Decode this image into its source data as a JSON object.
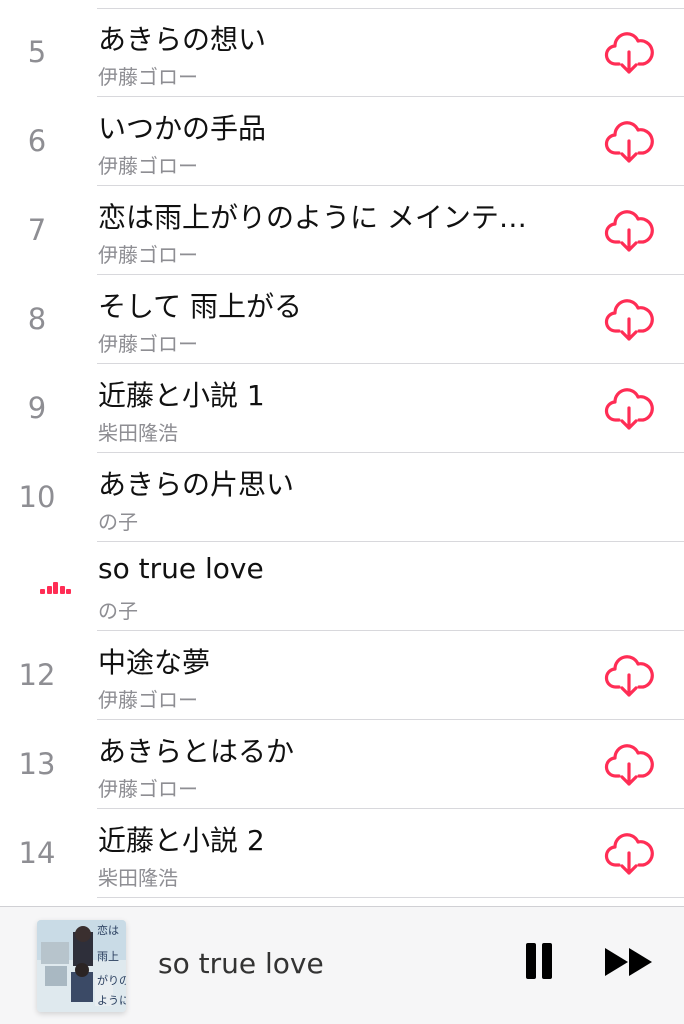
{
  "tracks": [
    {
      "num": "5",
      "title": "あきらの想い",
      "artist": "伊藤ゴロー",
      "downloadable": true,
      "playing": false
    },
    {
      "num": "6",
      "title": "いつかの手品",
      "artist": "伊藤ゴロー",
      "downloadable": true,
      "playing": false
    },
    {
      "num": "7",
      "title": "恋は雨上がりのように メインテ…",
      "artist": "伊藤ゴロー",
      "downloadable": true,
      "playing": false
    },
    {
      "num": "8",
      "title": "そして 雨上がる",
      "artist": "伊藤ゴロー",
      "downloadable": true,
      "playing": false
    },
    {
      "num": "9",
      "title": "近藤と小説 1",
      "artist": "柴田隆浩",
      "downloadable": true,
      "playing": false
    },
    {
      "num": "10",
      "title": "あきらの片思い",
      "artist": "の子",
      "downloadable": false,
      "playing": false
    },
    {
      "num": "",
      "title": "so true love",
      "artist": "の子",
      "downloadable": false,
      "playing": true
    },
    {
      "num": "12",
      "title": "中途な夢",
      "artist": "伊藤ゴロー",
      "downloadable": true,
      "playing": false
    },
    {
      "num": "13",
      "title": "あきらとはるか",
      "artist": "伊藤ゴロー",
      "downloadable": true,
      "playing": false
    },
    {
      "num": "14",
      "title": "近藤と小説 2",
      "artist": "柴田隆浩",
      "downloadable": true,
      "playing": false
    }
  ],
  "icons": {
    "download": "cloud-download-icon",
    "now_playing": "now-playing-bars-icon",
    "pause": "pause-icon",
    "forward": "fast-forward-icon"
  },
  "mini_player": {
    "title": "so true love",
    "artwork_text": "恋は雨上がりのように"
  },
  "colors": {
    "accent": "#ff2d55",
    "separator": "#d8d8dc",
    "secondary_text": "#8e8e93",
    "primary_text": "#111111",
    "mini_player_bg": "#f6f6f7"
  }
}
